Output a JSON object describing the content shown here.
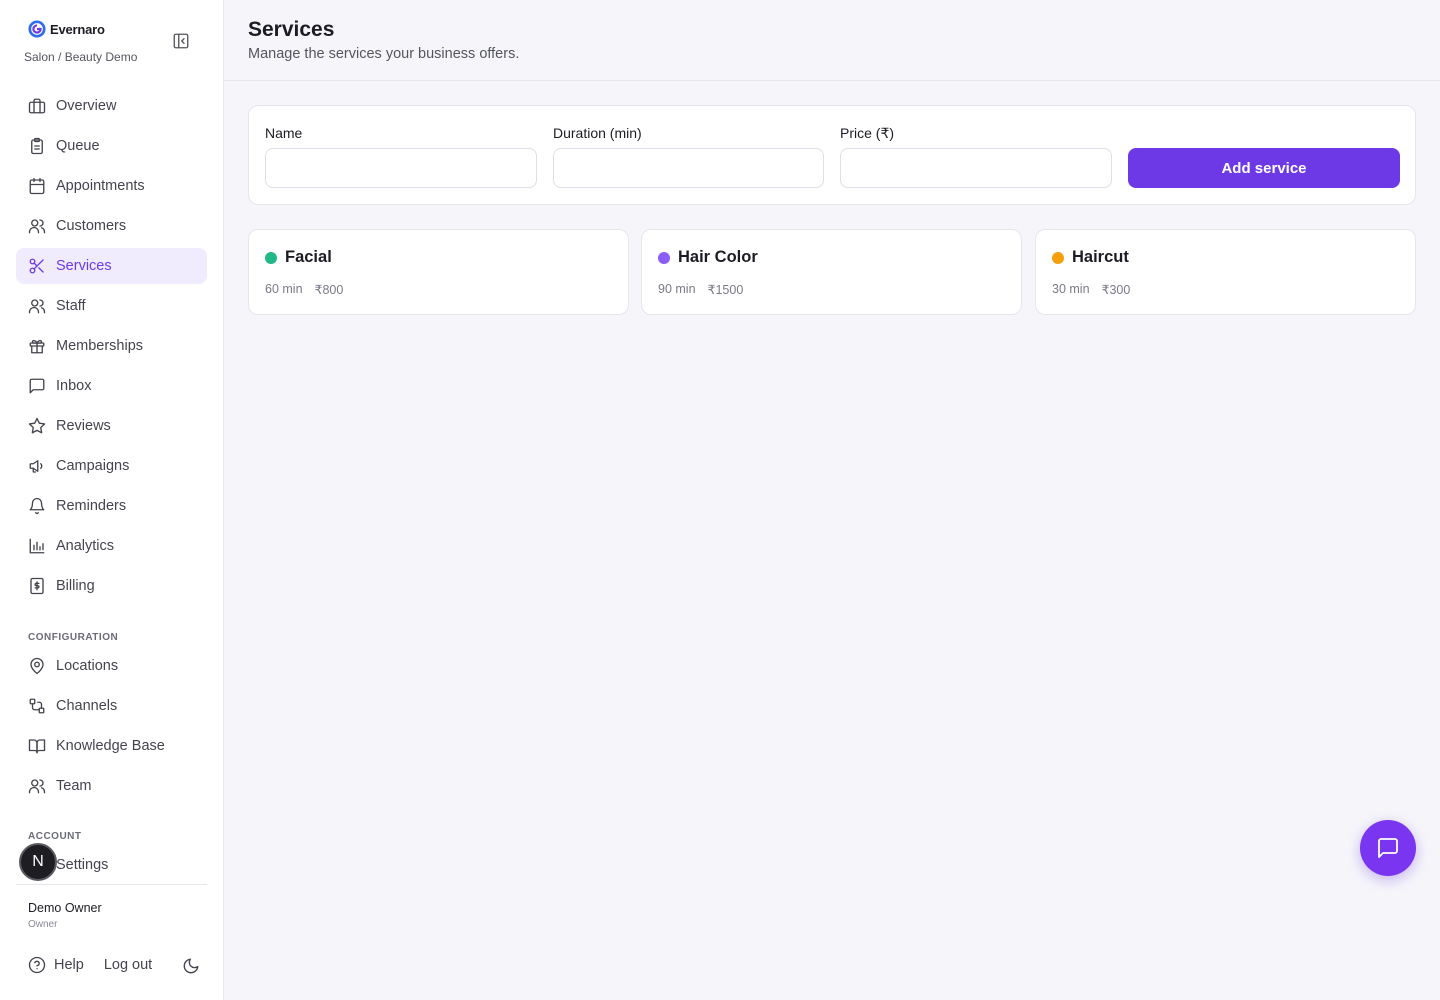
{
  "brand": {
    "name": "Evernaro",
    "subtitle": "Salon / Beauty Demo",
    "accent": "#6d38e6"
  },
  "nav": {
    "main": [
      {
        "label": "Overview",
        "icon": "briefcase-icon",
        "active": false
      },
      {
        "label": "Queue",
        "icon": "clipboard-icon",
        "active": false
      },
      {
        "label": "Appointments",
        "icon": "calendar-icon",
        "active": false
      },
      {
        "label": "Customers",
        "icon": "users-icon",
        "active": false
      },
      {
        "label": "Services",
        "icon": "scissors-icon",
        "active": true
      },
      {
        "label": "Staff",
        "icon": "users-icon",
        "active": false
      },
      {
        "label": "Memberships",
        "icon": "gift-icon",
        "active": false
      },
      {
        "label": "Inbox",
        "icon": "message-square-icon",
        "active": false
      },
      {
        "label": "Reviews",
        "icon": "star-icon",
        "active": false
      },
      {
        "label": "Campaigns",
        "icon": "megaphone-icon",
        "active": false
      },
      {
        "label": "Reminders",
        "icon": "bell-icon",
        "active": false
      },
      {
        "label": "Analytics",
        "icon": "bar-chart-icon",
        "active": false
      },
      {
        "label": "Billing",
        "icon": "receipt-icon",
        "active": false
      }
    ],
    "config_label": "CONFIGURATION",
    "config": [
      {
        "label": "Locations",
        "icon": "map-pin-icon"
      },
      {
        "label": "Channels",
        "icon": "workflow-icon"
      },
      {
        "label": "Knowledge Base",
        "icon": "book-open-icon"
      },
      {
        "label": "Team",
        "icon": "users-icon"
      }
    ],
    "account_label": "ACCOUNT",
    "account": [
      {
        "label": "Settings",
        "icon": "settings-icon"
      }
    ]
  },
  "user": {
    "name": "Demo Owner",
    "role": "Owner",
    "avatar_letter": "N"
  },
  "footer": {
    "help_label": "Help",
    "logout_label": "Log out"
  },
  "header": {
    "title": "Services",
    "subtitle": "Manage the services your business offers."
  },
  "form": {
    "name_label": "Name",
    "duration_label": "Duration (min)",
    "price_label": "Price (₹)",
    "name_value": "",
    "duration_value": "",
    "price_value": "",
    "submit_label": "Add service"
  },
  "services": [
    {
      "name": "Facial",
      "duration": "60 min",
      "price": "₹800",
      "color": "#1fb886"
    },
    {
      "name": "Hair Color",
      "duration": "90 min",
      "price": "₹1500",
      "color": "#8b5cf6"
    },
    {
      "name": "Haircut",
      "duration": "30 min",
      "price": "₹300",
      "color": "#f59e0b"
    }
  ]
}
